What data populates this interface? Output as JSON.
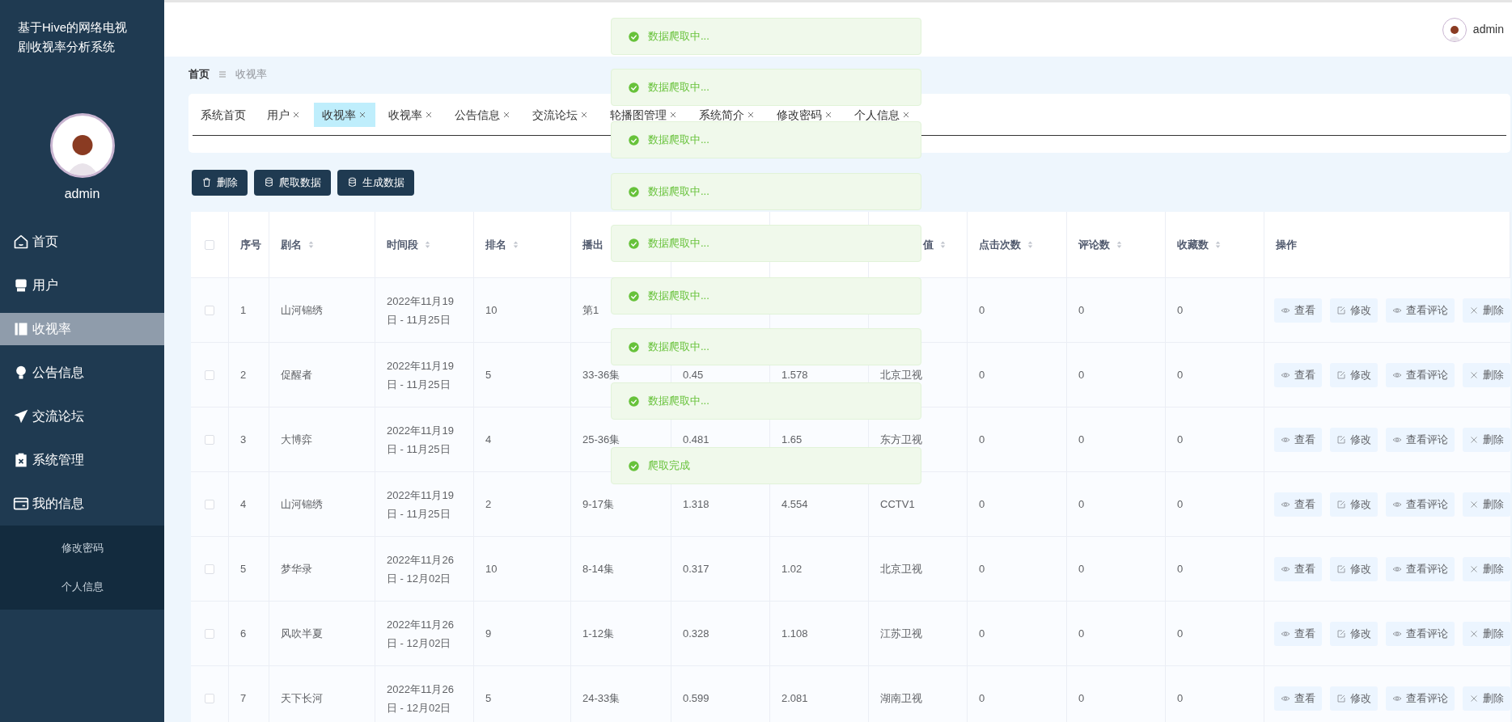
{
  "sidebar": {
    "title": "基于Hive的网络电视剧收视率分析系统",
    "user": "admin",
    "items": [
      {
        "kind": "home",
        "label": "首页",
        "selected": false
      },
      {
        "kind": "user",
        "label": "用户",
        "selected": false
      },
      {
        "kind": "book",
        "label": "收视率",
        "selected": true
      },
      {
        "kind": "bulb",
        "label": "公告信息",
        "selected": false
      },
      {
        "kind": "plane",
        "label": "交流论坛",
        "selected": false
      },
      {
        "kind": "clipboard",
        "label": "系统管理",
        "selected": false
      },
      {
        "kind": "card",
        "label": "我的信息",
        "selected": false,
        "expanded": true,
        "children": [
          {
            "label": "修改密码",
            "selected": false
          },
          {
            "label": "个人信息",
            "selected": false
          }
        ]
      }
    ]
  },
  "header": {
    "user": "admin"
  },
  "breadcrumb": [
    "首页",
    "收视率"
  ],
  "tabs": [
    {
      "label": "系统首页",
      "closable": false,
      "selected": false
    },
    {
      "label": "用户",
      "closable": true,
      "selected": false
    },
    {
      "label": "收视率",
      "closable": true,
      "selected": true
    },
    {
      "label": "收视率",
      "closable": true,
      "selected": false
    },
    {
      "label": "公告信息",
      "closable": true,
      "selected": false
    },
    {
      "label": "交流论坛",
      "closable": true,
      "selected": false
    },
    {
      "label": "轮播图管理",
      "closable": true,
      "selected": false
    },
    {
      "label": "系统简介",
      "closable": true,
      "selected": false
    },
    {
      "label": "修改密码",
      "closable": true,
      "selected": false
    },
    {
      "label": "个人信息",
      "closable": true,
      "selected": false
    }
  ],
  "toolbar": [
    {
      "kind": "delete",
      "label": "删除"
    },
    {
      "kind": "database",
      "label": "爬取数据"
    },
    {
      "kind": "database",
      "label": "生成数据"
    }
  ],
  "table": {
    "select_all": {
      "checked": false
    },
    "columns": [
      {
        "label": "序号",
        "sortable": false
      },
      {
        "label": "剧名",
        "sortable": true
      },
      {
        "label": "时间段",
        "sortable": true
      },
      {
        "label": "排名",
        "sortable": true
      },
      {
        "label": "播出"
      },
      null,
      null,
      {
        "label": "值",
        "sortable": true
      },
      {
        "label": "点击次数",
        "sortable": true
      },
      {
        "label": "评论数",
        "sortable": true
      },
      {
        "label": "收藏数",
        "sortable": true
      },
      {
        "label": "操作",
        "sortable": false
      }
    ],
    "rows": [
      {
        "checked": false,
        "cells": [
          "1",
          "山河锦绣",
          "2022年11月19日 - 11月25日",
          "10",
          "第1",
          null,
          null,
          null,
          "0",
          "0",
          "0"
        ],
        "actions": [
          {
            "kind": "view",
            "label": "查看"
          },
          {
            "kind": "edit",
            "label": "修改"
          },
          {
            "kind": "view",
            "label": "查看评论"
          },
          {
            "kind": "delete",
            "label": "删除"
          }
        ]
      },
      {
        "checked": false,
        "cells": [
          "2",
          "促醒者",
          "2022年11月19日 - 11月25日",
          "5",
          "33-36集",
          "0.45",
          "1.578",
          "北京卫视",
          "0",
          "0",
          "0"
        ],
        "actions": [
          {
            "kind": "view",
            "label": "查看"
          },
          {
            "kind": "edit",
            "label": "修改"
          },
          {
            "kind": "view",
            "label": "查看评论"
          },
          {
            "kind": "delete",
            "label": "删除"
          }
        ]
      },
      {
        "checked": false,
        "cells": [
          "3",
          "大博弈",
          "2022年11月19日 - 11月25日",
          "4",
          "25-36集",
          "0.481",
          "1.65",
          "东方卫视",
          "0",
          "0",
          "0"
        ],
        "actions": [
          {
            "kind": "view",
            "label": "查看"
          },
          {
            "kind": "edit",
            "label": "修改"
          },
          {
            "kind": "view",
            "label": "查看评论"
          },
          {
            "kind": "delete",
            "label": "删除"
          }
        ]
      },
      {
        "checked": false,
        "cells": [
          "4",
          "山河锦绣",
          "2022年11月19日 - 11月25日",
          "2",
          "9-17集",
          "1.318",
          "4.554",
          "CCTV1",
          "0",
          "0",
          "0"
        ],
        "actions": [
          {
            "kind": "view",
            "label": "查看"
          },
          {
            "kind": "edit",
            "label": "修改"
          },
          {
            "kind": "view",
            "label": "查看评论"
          },
          {
            "kind": "delete",
            "label": "删除"
          }
        ]
      },
      {
        "checked": false,
        "cells": [
          "5",
          "梦华录",
          "2022年11月26日 - 12月02日",
          "10",
          "8-14集",
          "0.317",
          "1.02",
          "北京卫视",
          "0",
          "0",
          "0"
        ],
        "actions": [
          {
            "kind": "view",
            "label": "查看"
          },
          {
            "kind": "edit",
            "label": "修改"
          },
          {
            "kind": "view",
            "label": "查看评论"
          },
          {
            "kind": "delete",
            "label": "删除"
          }
        ]
      },
      {
        "checked": false,
        "cells": [
          "6",
          "风吹半夏",
          "2022年11月26日 - 12月02日",
          "9",
          "1-12集",
          "0.328",
          "1.108",
          "江苏卫视",
          "0",
          "0",
          "0"
        ],
        "actions": [
          {
            "kind": "view",
            "label": "查看"
          },
          {
            "kind": "edit",
            "label": "修改"
          },
          {
            "kind": "view",
            "label": "查看评论"
          },
          {
            "kind": "delete",
            "label": "删除"
          }
        ]
      },
      {
        "checked": false,
        "cells": [
          "7",
          "天下长河",
          "2022年11月26日 - 12月02日",
          "5",
          "24-33集",
          "0.599",
          "2.081",
          "湖南卫视",
          "0",
          "0",
          "0"
        ],
        "actions": [
          {
            "kind": "view",
            "label": "查看"
          },
          {
            "kind": "edit",
            "label": "修改"
          },
          {
            "kind": "view",
            "label": "查看评论"
          },
          {
            "kind": "delete",
            "label": "删除"
          }
        ]
      }
    ]
  },
  "toasts": [
    {
      "kind": "success",
      "text": "数据爬取中..."
    },
    {
      "kind": "success",
      "text": "数据爬取中..."
    },
    {
      "kind": "success",
      "text": "数据爬取中..."
    },
    {
      "kind": "success",
      "text": "数据爬取中..."
    },
    {
      "kind": "success",
      "text": "数据爬取中..."
    },
    {
      "kind": "success",
      "text": "数据爬取中..."
    },
    {
      "kind": "success",
      "text": "数据爬取中..."
    },
    {
      "kind": "success",
      "text": "数据爬取中..."
    },
    {
      "kind": "success",
      "text": "爬取完成"
    }
  ]
}
